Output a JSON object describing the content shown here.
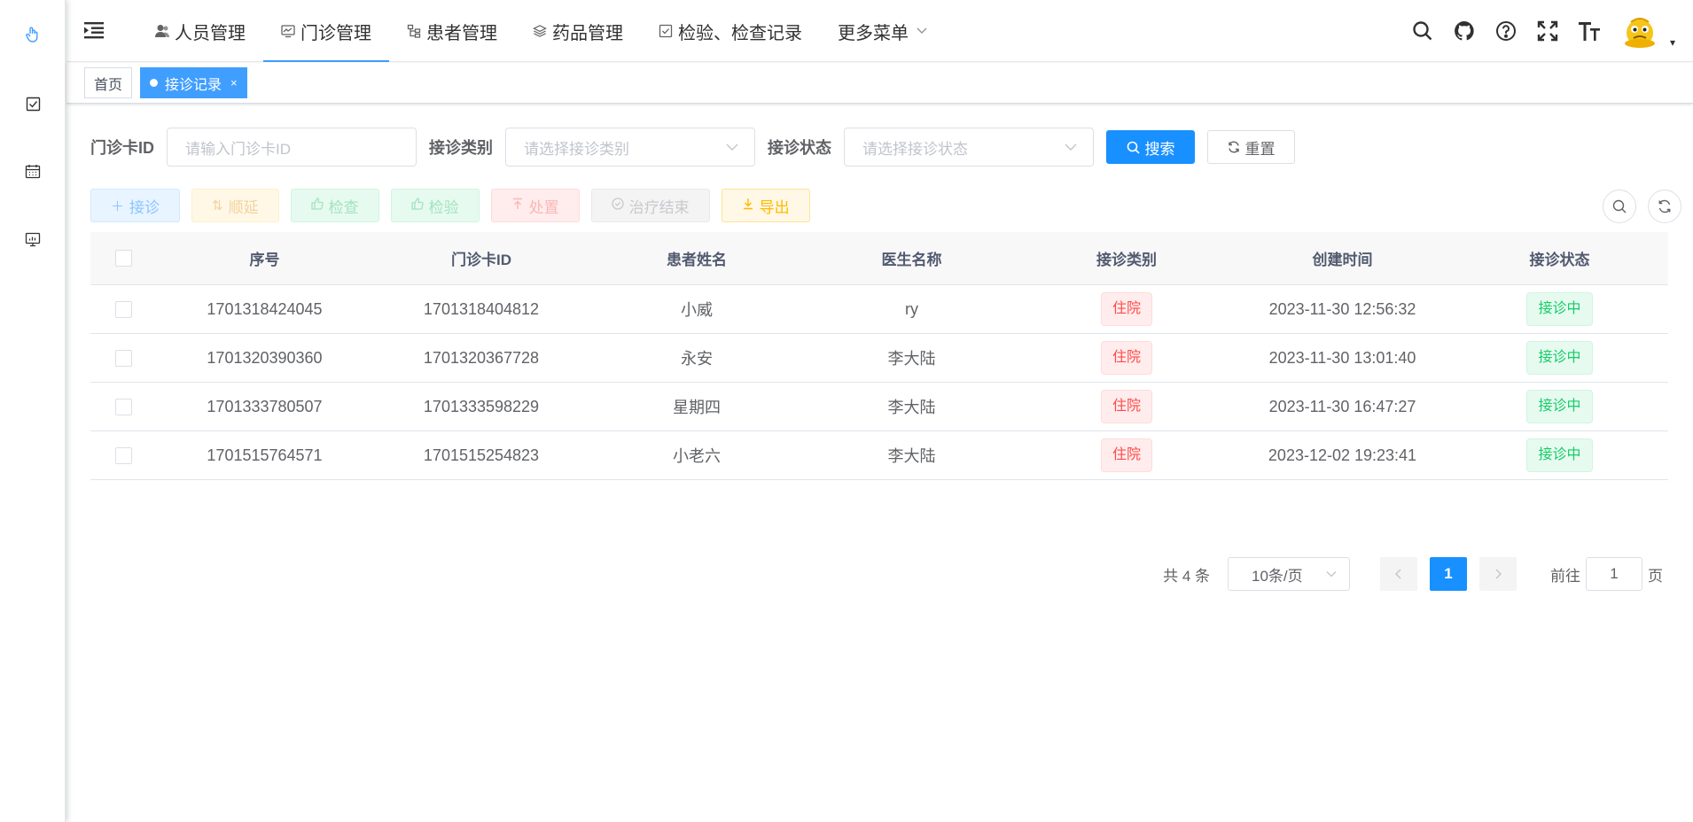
{
  "sidebar": {
    "icons": [
      "pointer-icon",
      "checkbox-icon",
      "calendar-icon",
      "monitor-chart-icon"
    ],
    "active_color": "#409eff"
  },
  "navbar": {
    "menu": [
      {
        "label": "人员管理",
        "icon": "user-icon"
      },
      {
        "label": "门诊管理",
        "icon": "monitor-icon",
        "active": true
      },
      {
        "label": "患者管理",
        "icon": "tree-icon"
      },
      {
        "label": "药品管理",
        "icon": "layers-icon"
      },
      {
        "label": "检验、检查记录",
        "icon": "checkbox-icon"
      },
      {
        "label": "更多菜单",
        "icon": "chevron-down-icon"
      }
    ],
    "tools": [
      "search-icon",
      "github-icon",
      "question-icon",
      "fullscreen-icon",
      "font-size-icon"
    ],
    "avatar_caret": "▾"
  },
  "tags": {
    "home": "首页",
    "current": "接诊记录",
    "close": "×"
  },
  "search_form": {
    "card_id_label": "门诊卡ID",
    "card_id_placeholder": "请输入门诊卡ID",
    "type_label": "接诊类别",
    "type_placeholder": "请选择接诊类别",
    "status_label": "接诊状态",
    "status_placeholder": "请选择接诊状态",
    "search_button": "搜索",
    "reset_button": "重置"
  },
  "toolbar": {
    "admit": "接诊",
    "postpone": "顺延",
    "exam": "检查",
    "test": "检验",
    "dispose": "处置",
    "end_treatment": "治疗结束",
    "export": "导出"
  },
  "table": {
    "headers": [
      "序号",
      "门诊卡ID",
      "患者姓名",
      "医生名称",
      "接诊类别",
      "创建时间",
      "接诊状态"
    ],
    "rows": [
      {
        "id": "1701318424045",
        "card_id": "1701318404812",
        "patient": "小威",
        "doctor": "ry",
        "type": "住院",
        "created": "2023-11-30 12:56:32",
        "status": "接诊中"
      },
      {
        "id": "1701320390360",
        "card_id": "1701320367728",
        "patient": "永安",
        "doctor": "李大陆",
        "type": "住院",
        "created": "2023-11-30 13:01:40",
        "status": "接诊中"
      },
      {
        "id": "1701333780507",
        "card_id": "1701333598229",
        "patient": "星期四",
        "doctor": "李大陆",
        "type": "住院",
        "created": "2023-11-30 16:47:27",
        "status": "接诊中"
      },
      {
        "id": "1701515764571",
        "card_id": "1701515254823",
        "patient": "小老六",
        "doctor": "李大陆",
        "type": "住院",
        "created": "2023-12-02 19:23:41",
        "status": "接诊中"
      }
    ]
  },
  "pagination": {
    "total": "共 4 条",
    "page_size": "10条/页",
    "current_page": "1",
    "goto_label": "前往",
    "goto_value": "1",
    "page_suffix": "页"
  },
  "colors": {
    "primary": "#1890ff",
    "danger": "#ff4949",
    "success": "#13ce66",
    "warning": "#ffba00"
  }
}
